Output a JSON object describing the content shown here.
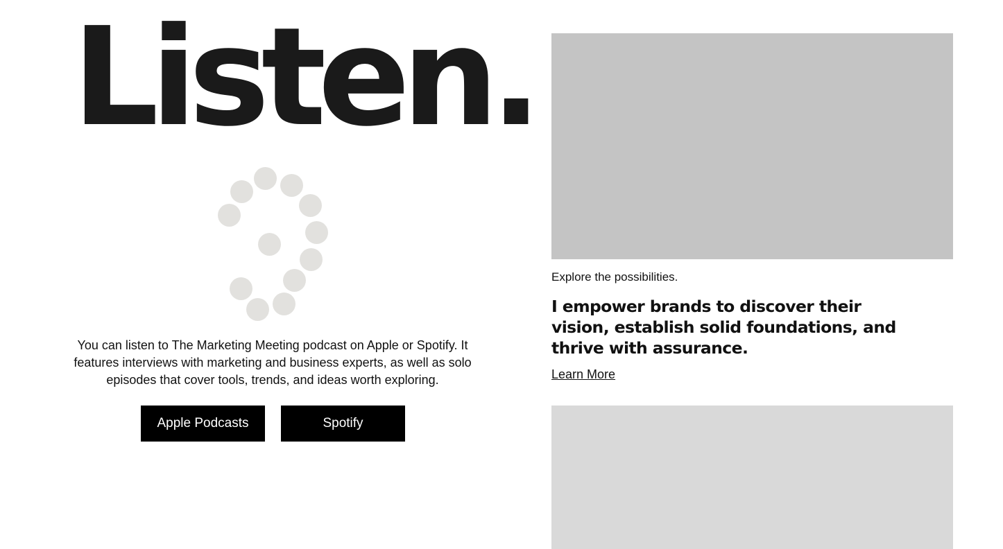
{
  "hero": {
    "title": "Listen."
  },
  "podcast": {
    "description": "You can listen to The Marketing Meeting podcast on Apple or Spotify. It features interviews with marketing and business experts, as well as solo episodes that cover tools, trends, and ideas worth exploring.",
    "apple_label": "Apple Podcasts",
    "spotify_label": "Spotify"
  },
  "feature": {
    "eyebrow": "Explore the possibilities.",
    "headline": "I empower brands to discover their vision, establish solid foundations, and thrive with assurance.",
    "link_label": "Learn More"
  },
  "colors": {
    "text": "#111111",
    "button_bg": "#000000",
    "button_text": "#ffffff",
    "placeholder_top": "#c4c4c4",
    "placeholder_bottom": "#d9d9d9",
    "loader_dot": "#e2e1de"
  },
  "icons": {
    "loader": "loading-spinner-icon"
  }
}
